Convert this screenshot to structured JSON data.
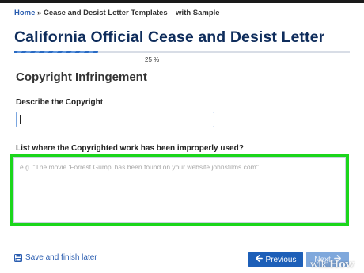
{
  "breadcrumb": {
    "home": "Home",
    "separator": " » ",
    "current": "Cease and Desist Letter Templates – with Sample"
  },
  "page_title": "California Official Cease and Desist Letter",
  "progress": {
    "percent": 25,
    "label": "25 %"
  },
  "section_title": "Copyright Infringement",
  "fields": {
    "describe": {
      "label": "Describe the Copyright",
      "value": "",
      "placeholder": ""
    },
    "improper_use": {
      "label": "List where the Copyrighted work has been improperly used?",
      "value": "",
      "placeholder": "e.g. \"The movie 'Forrest Gump' has been found on your website johnsfilms.com\""
    }
  },
  "footer": {
    "save_label": "Save and finish later",
    "save_icon": "floppy-disk-icon",
    "previous_label": "Previous",
    "previous_icon": "arrow-left-icon",
    "next_label": "Next",
    "next_icon": "arrow-right-icon"
  },
  "watermark": {
    "wiki": "wiki",
    "how": "How"
  },
  "colors": {
    "title": "#0f2d5c",
    "link": "#2a5db0",
    "primary_button": "#1d5fb8",
    "disabled_button": "#7fa8dc",
    "highlight": "#1bd61b"
  }
}
